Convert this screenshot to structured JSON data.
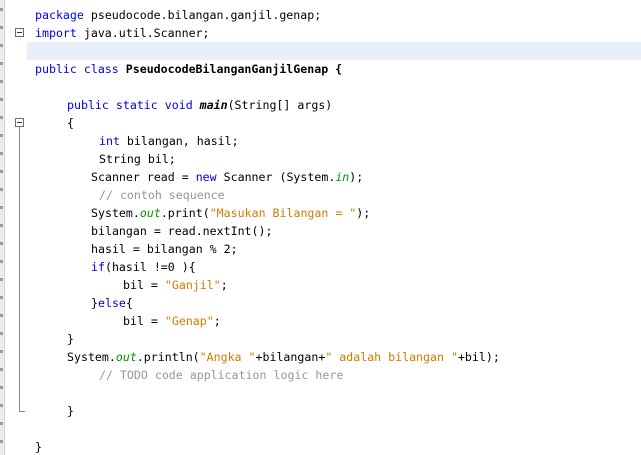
{
  "code": {
    "l1_kw": "package",
    "l1_rest": " pseudocode.bilangan.ganjil.genap;",
    "l2_kw": "import",
    "l2_rest": " java.util.Scanner;",
    "l3_kw1": "public",
    "l3_kw2": "class",
    "l3_name": " PseudocodeBilanganGanjilGenap {",
    "l4_kw1": "public",
    "l4_kw2": "static",
    "l4_kw3": "void",
    "l4_method": "main",
    "l4_rest": "(String[] args)",
    "l5": "{",
    "l6_kw": "int",
    "l6_rest": " bilangan, hasil;",
    "l7": "String bil;",
    "l8_a": "Scanner read = ",
    "l8_kw": "new",
    "l8_b": " Scanner (System.",
    "l8_fld": "in",
    "l8_c": ");",
    "l9": "// contoh sequence",
    "l10_a": "System.",
    "l10_fld": "out",
    "l10_b": ".print(",
    "l10_str": "\"Masukan Bilangan = \"",
    "l10_c": ");",
    "l11": "bilangan = read.nextInt();",
    "l12": "hasil = bilangan % 2;",
    "l13_kw": "if",
    "l13_rest": "(hasil !=0 ){",
    "l14_a": "bil = ",
    "l14_str": "\"Ganjil\"",
    "l14_b": ";",
    "l15_a": "}",
    "l15_kw": "else",
    "l15_b": "{",
    "l16_a": "bil = ",
    "l16_str": "\"Genap\"",
    "l16_b": ";",
    "l17": "}",
    "l18_a": "System.",
    "l18_fld": "out",
    "l18_b": ".println(",
    "l18_str1": "\"Angka \"",
    "l18_c": "+bilangan+",
    "l18_str2": "\" adalah bilangan \"",
    "l18_d": "+bil);",
    "l19": "// TODO code application logic here",
    "l20": "}",
    "l21": "}"
  }
}
